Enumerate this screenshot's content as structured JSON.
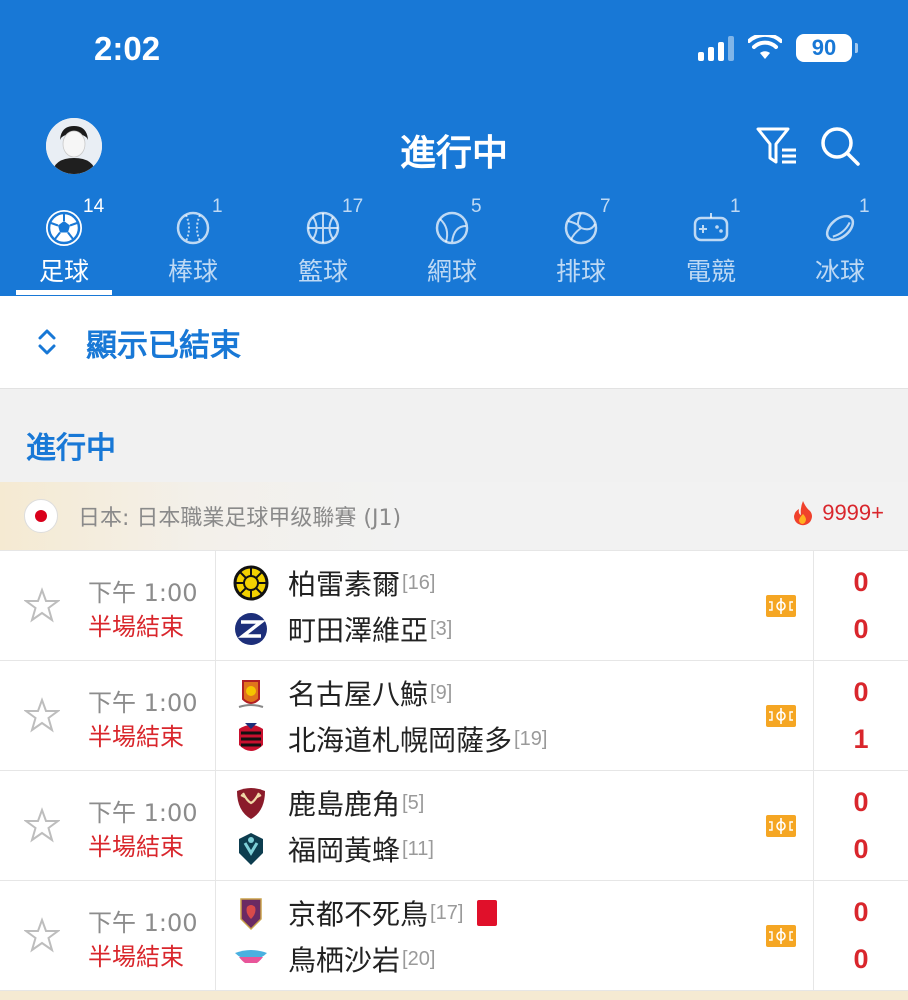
{
  "status_bar": {
    "time": "2:02",
    "battery": "90"
  },
  "header": {
    "title": "進行中"
  },
  "tabs": [
    {
      "label": "足球",
      "count": "14",
      "icon": "soccer-ball-icon",
      "active": true
    },
    {
      "label": "棒球",
      "count": "1",
      "icon": "baseball-icon"
    },
    {
      "label": "籃球",
      "count": "17",
      "icon": "basketball-icon"
    },
    {
      "label": "網球",
      "count": "5",
      "icon": "tennis-ball-icon"
    },
    {
      "label": "排球",
      "count": "7",
      "icon": "volleyball-icon"
    },
    {
      "label": "電競",
      "count": "1",
      "icon": "gamepad-icon"
    },
    {
      "label": "冰球",
      "count": "1",
      "icon": "hockey-puck-icon"
    }
  ],
  "show_ended": {
    "label": "顯示已結束"
  },
  "section": {
    "label": "進行中"
  },
  "league": {
    "name": "日本: 日本職業足球甲级聯賽 (J1)",
    "hot_count": "9999+"
  },
  "matches": [
    {
      "time": "下午 1:00",
      "status": "半場結束",
      "home": {
        "name": "柏雷素爾",
        "rank": "[16]"
      },
      "away": {
        "name": "町田澤維亞",
        "rank": "[3]"
      },
      "home_score": "0",
      "away_score": "0"
    },
    {
      "time": "下午 1:00",
      "status": "半場結束",
      "home": {
        "name": "名古屋八鯨",
        "rank": "[9]"
      },
      "away": {
        "name": "北海道札幌岡薩多",
        "rank": "[19]"
      },
      "home_score": "0",
      "away_score": "1"
    },
    {
      "time": "下午 1:00",
      "status": "半場結束",
      "home": {
        "name": "鹿島鹿角",
        "rank": "[5]"
      },
      "away": {
        "name": "福岡黃蜂",
        "rank": "[11]"
      },
      "home_score": "0",
      "away_score": "0"
    },
    {
      "time": "下午 1:00",
      "status": "半場結束",
      "home": {
        "name": "京都不死鳥",
        "rank": "[17]"
      },
      "away": {
        "name": "鳥栖沙岩",
        "rank": "[20]"
      },
      "home_score": "0",
      "away_score": "0"
    }
  ],
  "colors": {
    "primary": "#1878d6",
    "live_red": "#d9262c",
    "red_card": "#e0102a",
    "field_icon": "#f5a623"
  }
}
